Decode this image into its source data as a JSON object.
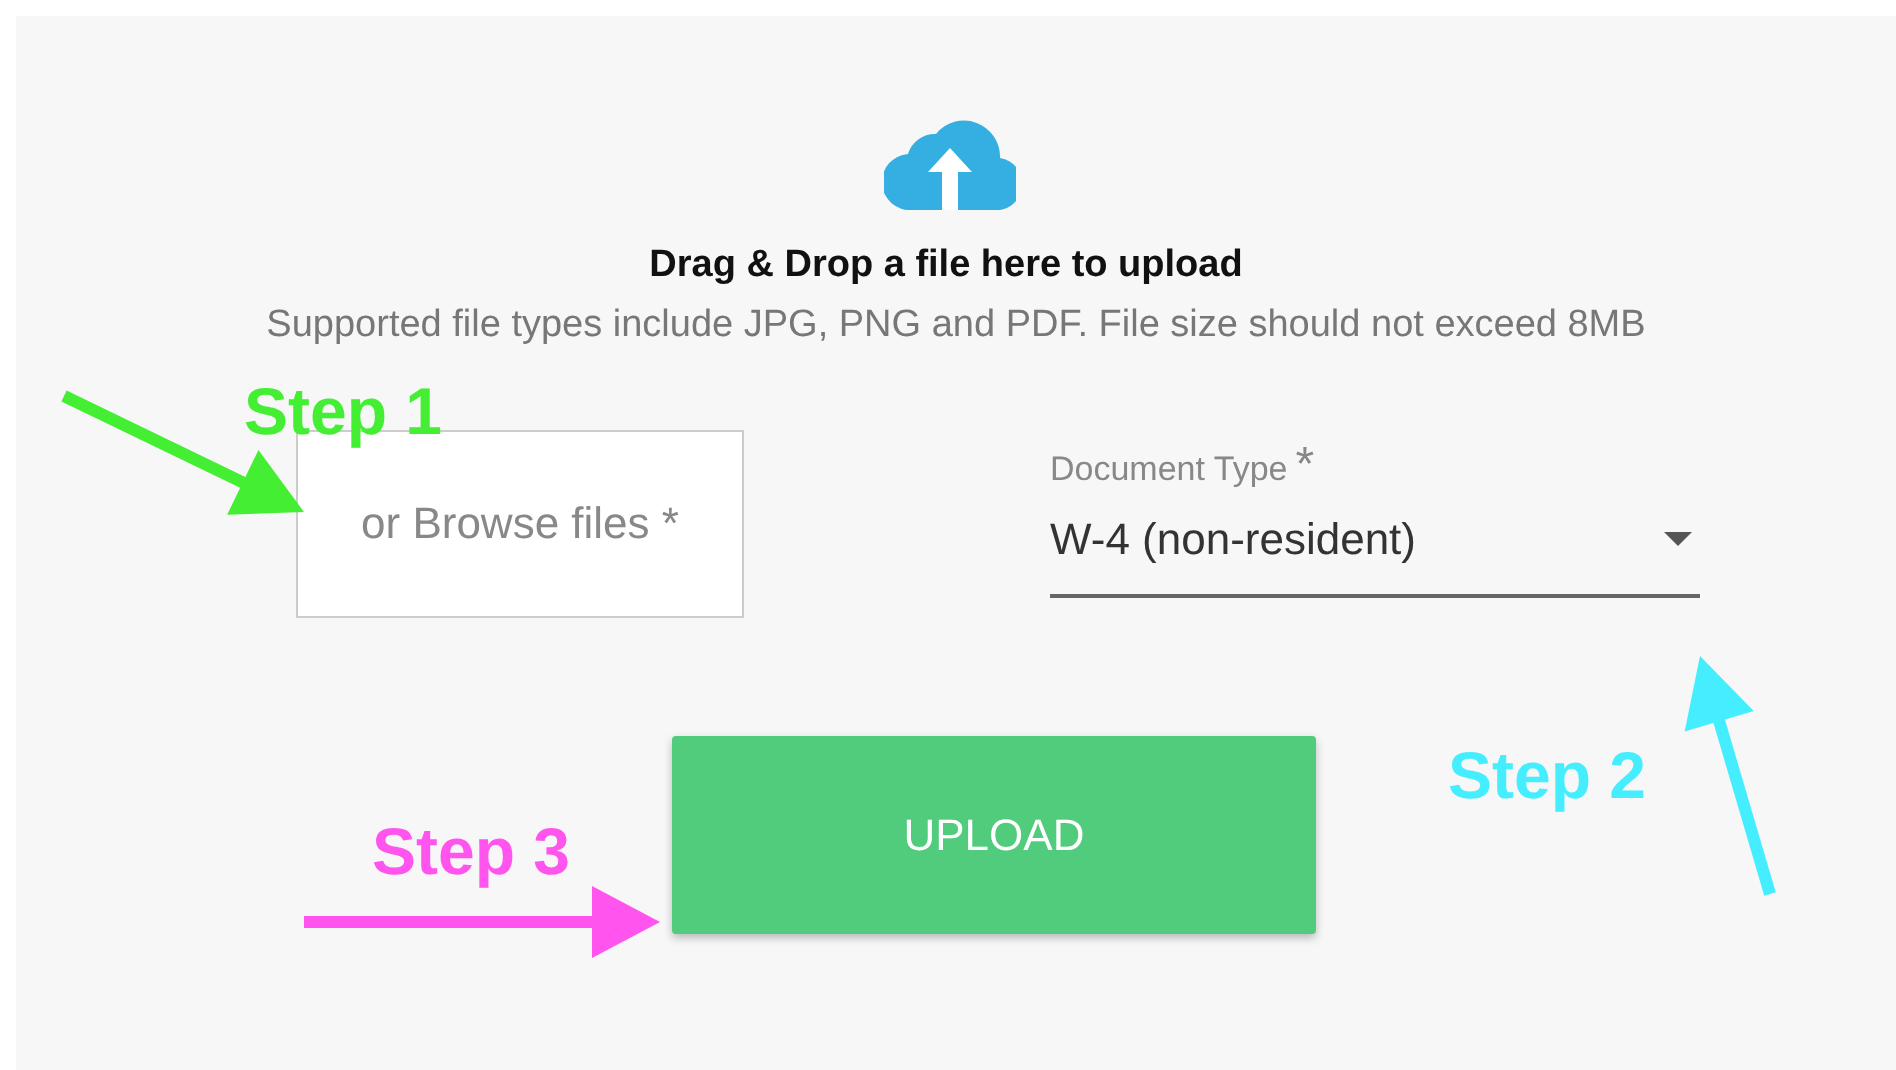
{
  "upload_panel": {
    "heading": "Drag & Drop a file here to upload",
    "subtitle": "Supported file types include JPG, PNG and PDF. File size should not exceed 8MB",
    "browse_button": "or Browse files *",
    "document_type": {
      "label": "Document Type",
      "required_mark": "*",
      "value": "W-4 (non-resident)"
    },
    "upload_button": "UPLOAD"
  },
  "annotations": [
    {
      "label": "Step 1",
      "color": "#44ee33"
    },
    {
      "label": "Step 2",
      "color": "#44eeff"
    },
    {
      "label": "Step 3",
      "color": "#ff55ee"
    }
  ]
}
